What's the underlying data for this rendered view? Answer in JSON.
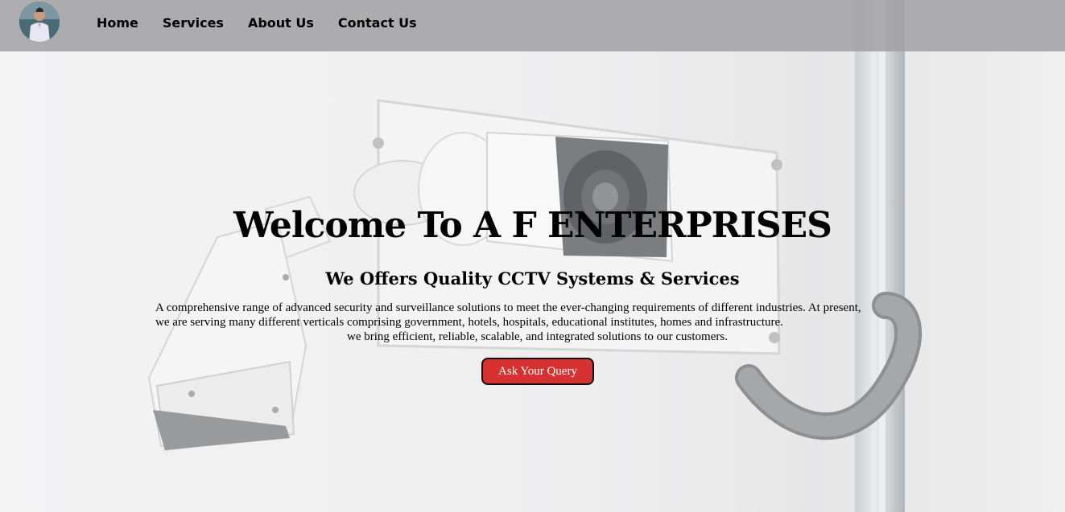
{
  "nav": {
    "logo_icon": "profile-photo",
    "links": [
      "Home",
      "Services",
      "About Us",
      "Contact Us"
    ]
  },
  "hero": {
    "title": "Welcome To A F ENTERPRISES",
    "subtitle": "We Offers Quality CCTV Systems & Services",
    "description_line1": "A comprehensive range of advanced security and surveillance solutions to meet the ever-changing requirements of different industries. At present,",
    "description_line2": "we are serving many different verticals comprising government, hotels, hospitals, educational institutes, homes and infrastructure.",
    "description_line3": "we bring efficient, reliable, scalable, and integrated solutions to our customers.",
    "cta_label": "Ask Your Query",
    "background_icon": "cctv-camera-image"
  },
  "colors": {
    "navbar": "#a0a0a2",
    "cta": "#d63232",
    "background": "#e9e9ea"
  }
}
